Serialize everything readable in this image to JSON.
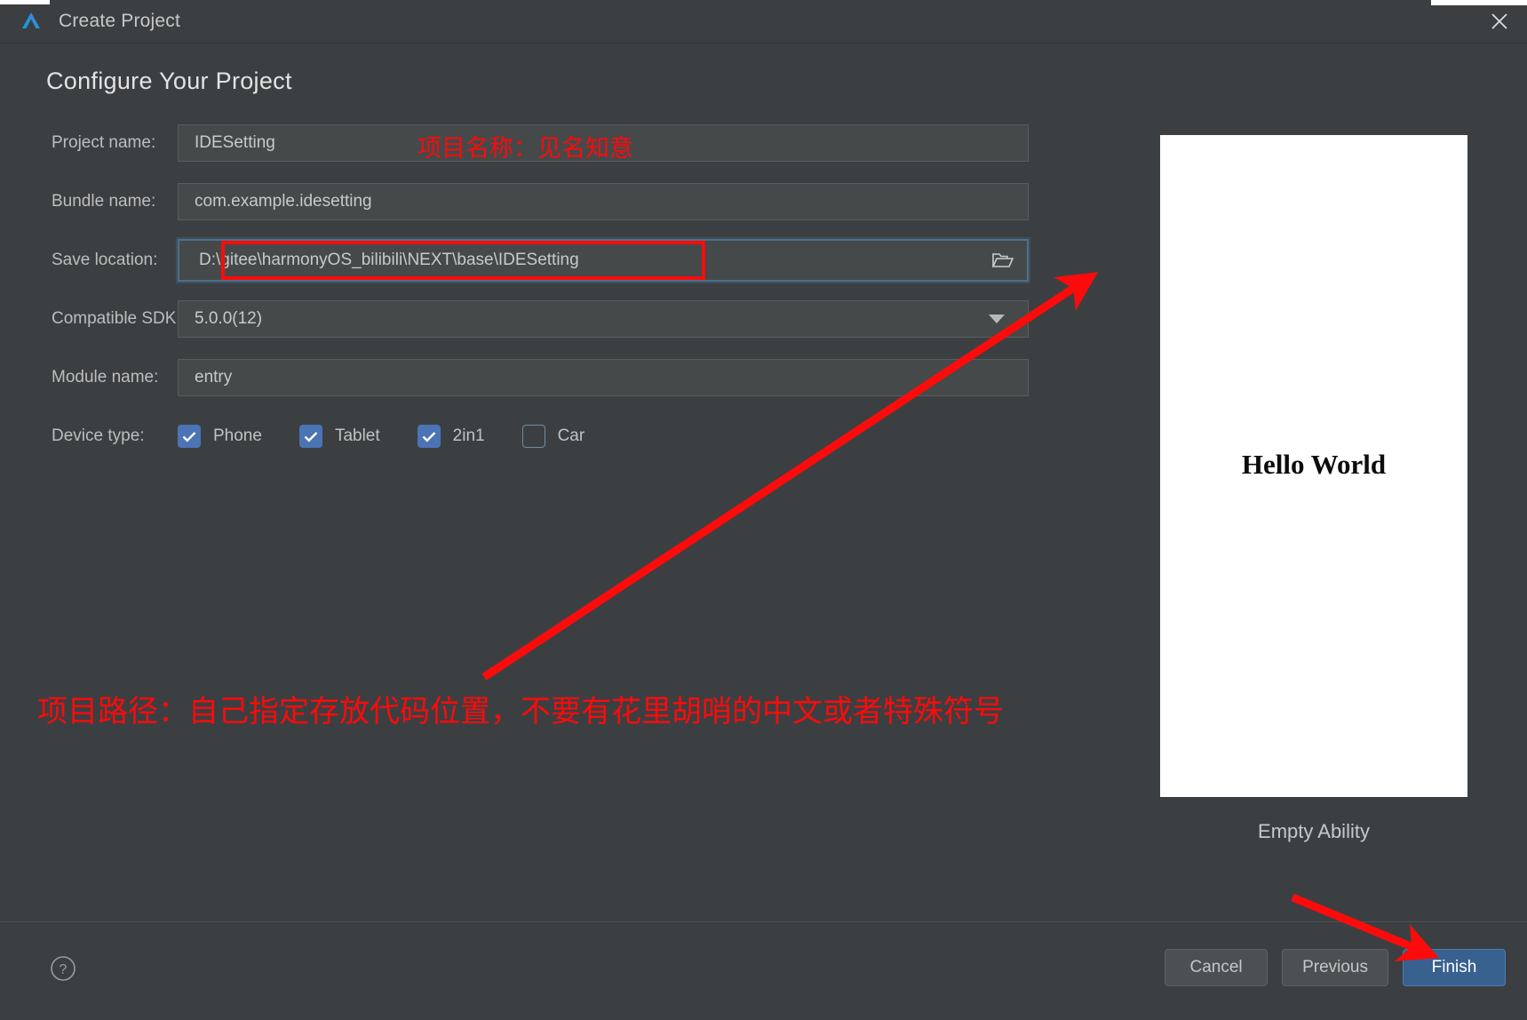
{
  "window": {
    "title": "Create Project",
    "logo_icon": "harmonyos-logo-icon",
    "close_icon": "close-icon"
  },
  "page": {
    "heading": "Configure Your Project"
  },
  "form": {
    "rows": [
      {
        "label": "Project name:",
        "value": "IDESetting",
        "type": "text"
      },
      {
        "label": "Bundle name:",
        "value": "com.example.idesetting",
        "type": "text"
      },
      {
        "label": "Save location:",
        "value": "D:\\gitee\\harmonyOS_bilibili\\NEXT\\base\\IDESetting",
        "type": "path"
      },
      {
        "label": "Compatible SDK:",
        "value": "5.0.0(12)",
        "type": "select"
      },
      {
        "label": "Module name:",
        "value": "entry",
        "type": "text"
      }
    ],
    "device_type": {
      "label": "Device type:",
      "options": [
        {
          "label": "Phone",
          "checked": true
        },
        {
          "label": "Tablet",
          "checked": true
        },
        {
          "label": "2in1",
          "checked": true
        },
        {
          "label": "Car",
          "checked": false
        }
      ]
    },
    "icons": {
      "folder": "folder-open-icon",
      "dropdown": "chevron-down-icon"
    }
  },
  "preview": {
    "screen_text": "Hello World",
    "caption": "Empty Ability"
  },
  "footer": {
    "help_icon": "help-circle-icon",
    "buttons": [
      {
        "label": "Cancel",
        "primary": false
      },
      {
        "label": "Previous",
        "primary": false
      },
      {
        "label": "Finish",
        "primary": true
      }
    ]
  },
  "annotations": {
    "project_name_note": "项目名称：见名知意",
    "path_note": "项目路径：自己指定存放代码位置，不要有花里胡哨的中文或者特殊符号",
    "color": "#FB0B0B",
    "highlight_box_target": "Save location value",
    "arrows": [
      {
        "from": "path-note",
        "to": "save-location-browse-button"
      },
      {
        "from": "below-left",
        "to": "finish-button"
      }
    ]
  },
  "colors": {
    "window_bg": "#3C3F41",
    "field_bg": "#45494A",
    "accent_blue": "#38618F",
    "checkbox_blue": "#4B74B5",
    "annotation_red": "#FB0B0B"
  }
}
